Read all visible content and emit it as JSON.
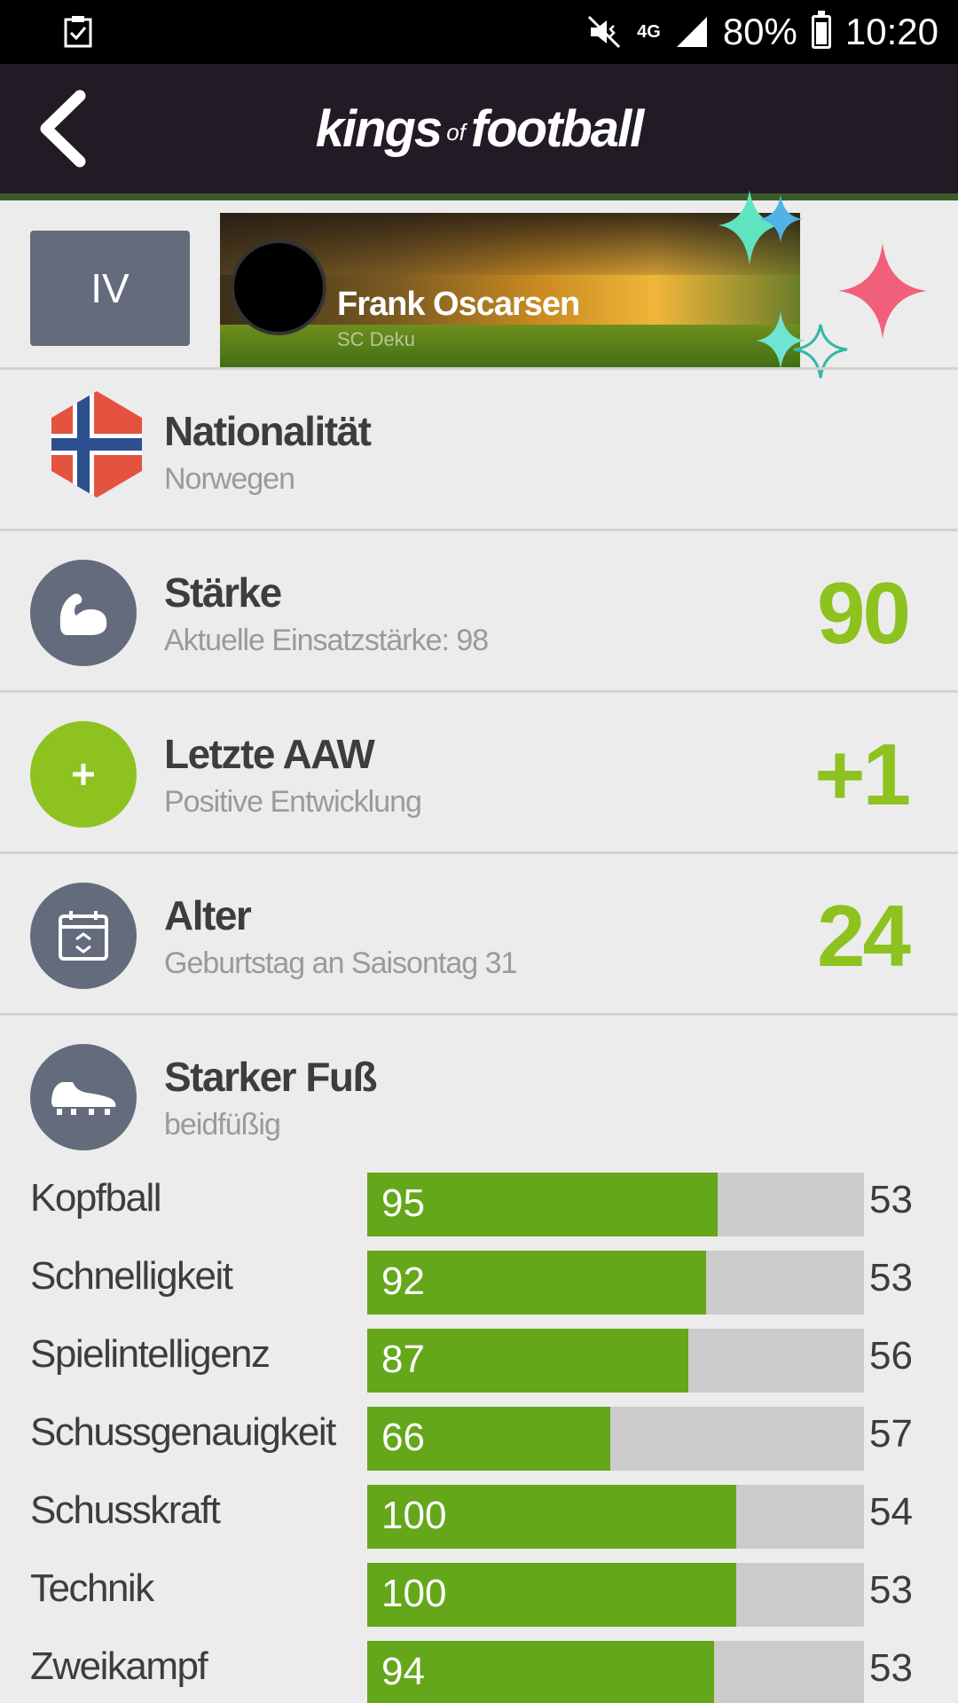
{
  "status_bar": {
    "network": "4G",
    "battery": "80%",
    "time": "10:20"
  },
  "app": {
    "logo_left": "kings",
    "logo_mid": "of",
    "logo_right": "football"
  },
  "player": {
    "position": "IV",
    "name": "Frank Oscarsen",
    "club": "SC Deku"
  },
  "rows": {
    "nationality": {
      "title": "Nationalität",
      "sub": "Norwegen"
    },
    "strength": {
      "title": "Stärke",
      "sub": "Aktuelle Einsatzstärke: 98",
      "value": "90"
    },
    "last_aaw": {
      "title": "Letzte AAW",
      "sub": "Positive Entwicklung",
      "value": "+1"
    },
    "age": {
      "title": "Alter",
      "sub": "Geburtstag an Saisontag 31",
      "value": "24"
    },
    "foot": {
      "title": "Starker Fuß",
      "sub": "beidfüßig"
    }
  },
  "stats": [
    {
      "label": "Kopfball",
      "value": 95,
      "avg": 53
    },
    {
      "label": "Schnelligkeit",
      "value": 92,
      "avg": 53
    },
    {
      "label": "Spielintelligenz",
      "value": 87,
      "avg": 56
    },
    {
      "label": "Schussgenauigkeit",
      "value": 66,
      "avg": 57
    },
    {
      "label": "Schusskraft",
      "value": 100,
      "avg": 54
    },
    {
      "label": "Technik",
      "value": 100,
      "avg": 53
    },
    {
      "label": "Zweikampf",
      "value": 94,
      "avg": 53
    }
  ],
  "colors": {
    "accent_green": "#8dc21f",
    "bar_green": "#64a71a",
    "header_dark": "#221b26",
    "icon_gray": "#646b7d"
  }
}
